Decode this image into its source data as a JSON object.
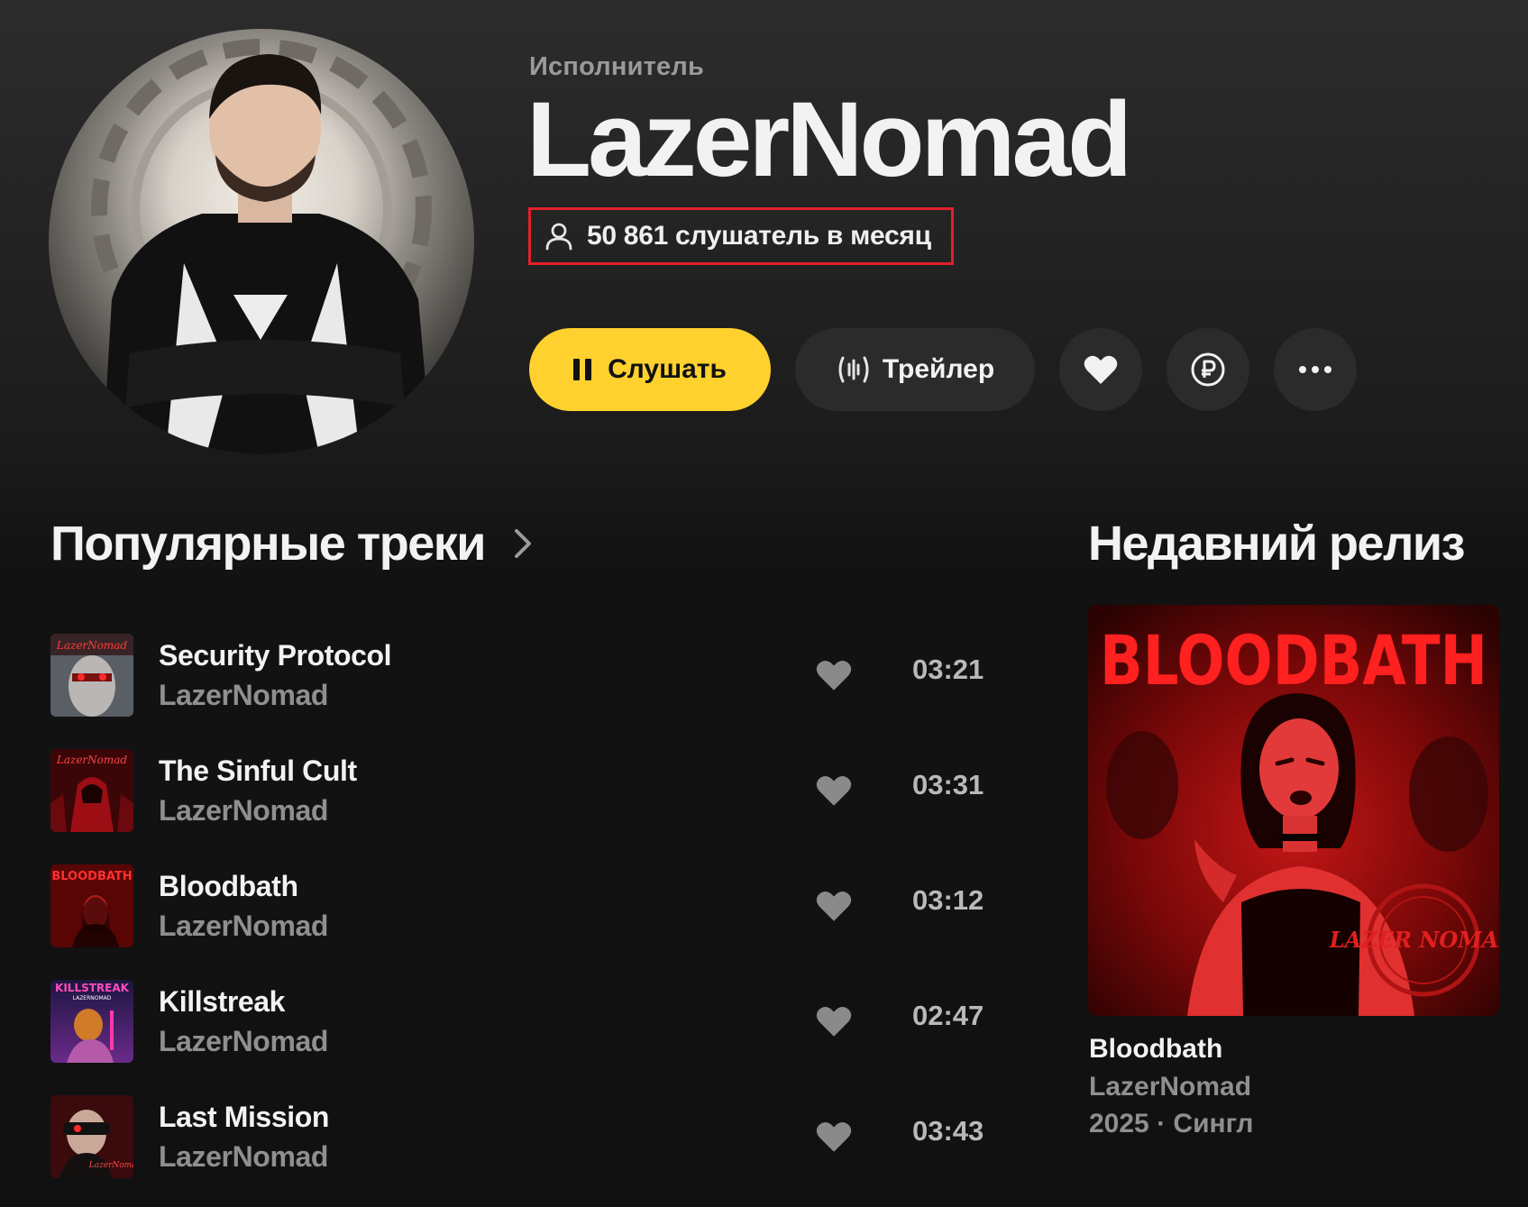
{
  "artist": {
    "role_label": "Исполнитель",
    "name": "LazerNomad",
    "monthly_listeners": "50 861 слушатель в месяц"
  },
  "actions": {
    "listen_label": "Слушать",
    "trailer_label": "Трейлер"
  },
  "popular": {
    "title": "Популярные треки",
    "tracks": [
      {
        "title": "Security Protocol",
        "artist": "LazerNomad",
        "duration": "03:21"
      },
      {
        "title": "The Sinful Cult",
        "artist": "LazerNomad",
        "duration": "03:31"
      },
      {
        "title": "Bloodbath",
        "artist": "LazerNomad",
        "duration": "03:12"
      },
      {
        "title": "Killstreak",
        "artist": "LazerNomad",
        "duration": "02:47"
      },
      {
        "title": "Last Mission",
        "artist": "LazerNomad",
        "duration": "03:43"
      }
    ],
    "cover_texts": [
      "LazerNomad",
      "LazerNomad",
      "BLOODBATH",
      "KILLSTREAK",
      "LazerNomad"
    ],
    "cover_subtexts": [
      "",
      "",
      "",
      "LAZERNOMAD",
      ""
    ]
  },
  "recent": {
    "title": "Недавний релиз",
    "cover_text": "BLOODBATH",
    "cover_logo": "LAZER NOMAD",
    "release_title": "Bloodbath",
    "release_artist": "LazerNomad",
    "release_meta": "2025 · Сингл"
  },
  "colors": {
    "accent_yellow": "#ffd12e",
    "highlight_red": "#e3202c",
    "button_dark": "#2b2b2b",
    "muted_text": "#8f8f8f"
  },
  "icons": {
    "listeners": "user-icon",
    "listen": "pause-icon",
    "trailer": "trailer-wave-icon",
    "like": "heart-icon",
    "donate": "ruble-icon",
    "more": "more-dots-icon",
    "chevron": "chevron-right-icon"
  }
}
